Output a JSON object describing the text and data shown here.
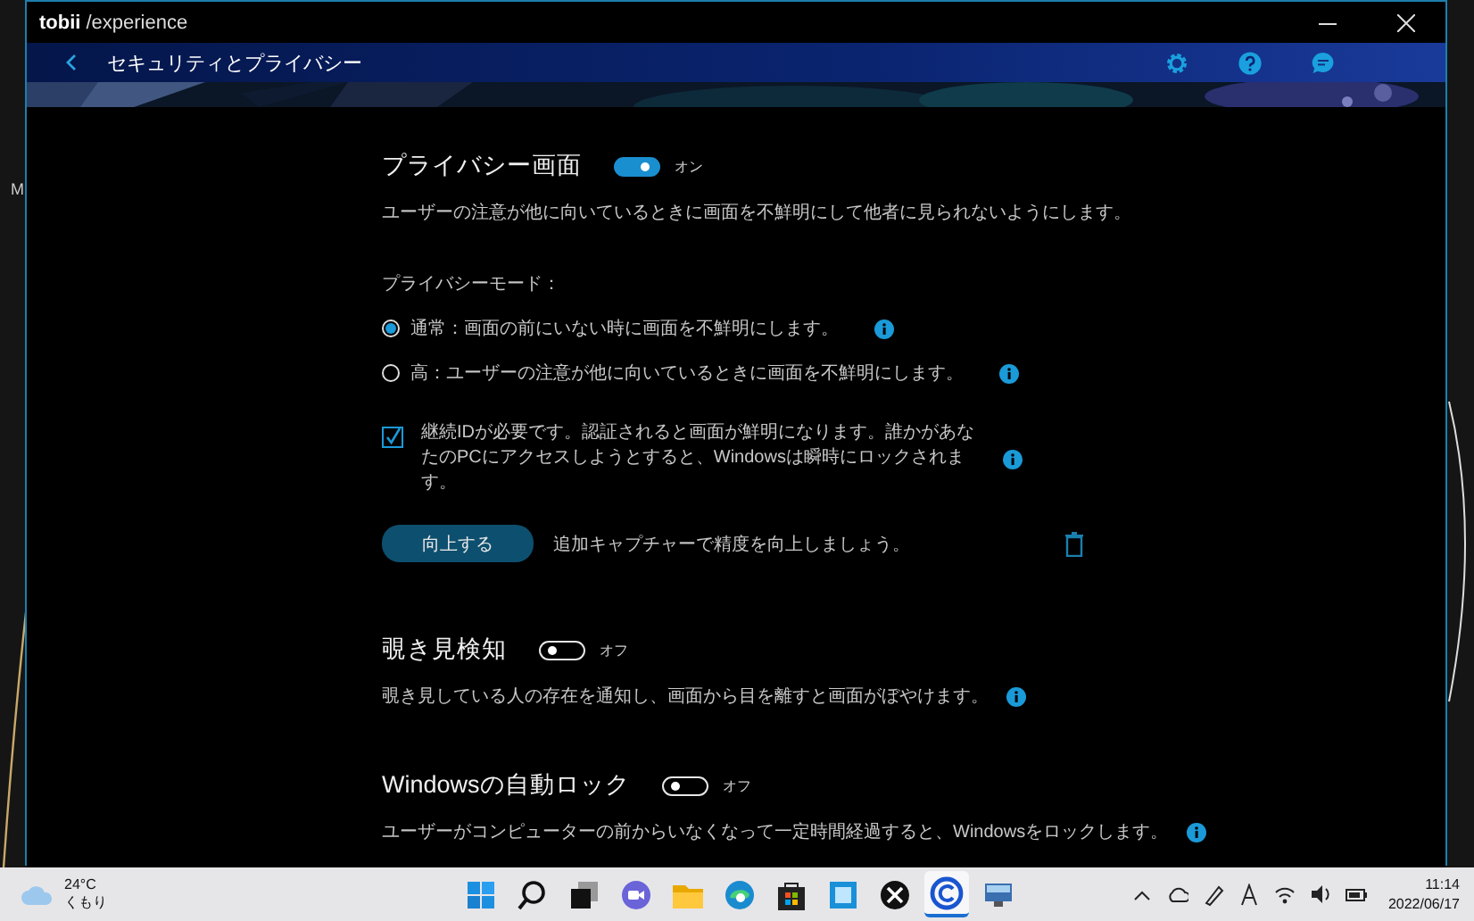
{
  "desktop": {
    "label": "M"
  },
  "window": {
    "brand": "tobii",
    "product": "/experience"
  },
  "nav": {
    "title": "セキュリティとプライバシー"
  },
  "sections": [
    {
      "kind": "privacy",
      "title": "プライバシー画面",
      "on": true,
      "toggle_label": "オン",
      "description": "ユーザーの注意が他に向いているときに画面を不鮮明にして他者に見られないようにします。",
      "mode_label": "プライバシーモード：",
      "modes": [
        {
          "label": "通常：画面の前にいない時に画面を不鮮明にします。",
          "selected": true
        },
        {
          "label": "高：ユーザーの注意が他に向いているときに画面を不鮮明にします。",
          "selected": false
        }
      ],
      "checkbox": {
        "checked": true,
        "text": "継続IDが必要です。認証されると画面が鮮明になります。誰かがあなたのPCにアクセスしようとすると、Windowsは瞬時にロックされます。"
      },
      "improve": {
        "button": "向上する",
        "text": "追加キャプチャーで精度を向上しましょう。"
      }
    },
    {
      "kind": "simple",
      "title": "覗き見検知",
      "on": false,
      "toggle_label": "オフ",
      "description": "覗き見している人の存在を通知し、画面から目を離すと画面がぼやけます。"
    },
    {
      "kind": "simple",
      "title": "Windowsの自動ロック",
      "on": false,
      "toggle_label": "オフ",
      "description": "ユーザーがコンピューターの前からいなくなって一定時間経過すると、Windowsをロックします。"
    }
  ],
  "taskbar": {
    "weather": {
      "temp": "24°C",
      "condition": "くもり"
    },
    "apps": [
      {
        "kind": "start",
        "selected": false
      },
      {
        "kind": "search",
        "selected": false
      },
      {
        "kind": "taskview",
        "selected": false
      },
      {
        "kind": "chat",
        "selected": false
      },
      {
        "kind": "folder",
        "selected": false
      },
      {
        "kind": "browser",
        "selected": false
      },
      {
        "kind": "store",
        "selected": false
      },
      {
        "kind": "app",
        "selected": false
      },
      {
        "kind": "xcircle",
        "selected": false
      },
      {
        "kind": "clogo",
        "selected": true
      },
      {
        "kind": "monitor",
        "selected": false
      }
    ],
    "clock": {
      "time": "11:14",
      "date": "2022/06/17"
    }
  }
}
